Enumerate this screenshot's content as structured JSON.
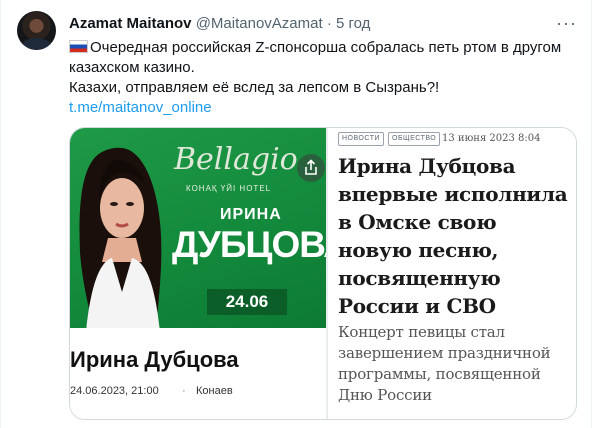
{
  "tweet": {
    "author_name": "Azamat Maitanov",
    "handle": "@MaitanovAzamat",
    "separator": "·",
    "time": "5 год",
    "more_label": "···",
    "text_line1": "Очередная российская Z-спонсорша собралась петь ртом в другом казахском казино.",
    "text_line2": "Казахи, отправляем её вслед за лепсом в Сызрань?!",
    "link": "t.me/maitanov_online",
    "flag_icon": "russia-flag-icon"
  },
  "poster": {
    "venue": "Bellagio",
    "venue_sub": "КОНАҚ ҮЙІ HOTEL",
    "singer_first": "ИРИНА",
    "singer_last": "ДУБЦОВА",
    "date": "24.06",
    "colors": {
      "green": "#1a9444",
      "dark_green": "#0b5e28"
    }
  },
  "caption": {
    "title": "Ирина Дубцова",
    "datetime": "24.06.2023, 21:00",
    "separator": "·",
    "place": "Конаев"
  },
  "article": {
    "tags": [
      "НОВОСТИ",
      "ОБЩЕСТВО"
    ],
    "date": "13 июня 2023 8:04",
    "headline": "Ирина Дубцова впервые исполнила в Омске свою новую песню, посвященную России и СВО",
    "lead": "Концерт певицы стал завершением праздничной программы, посвященной Дню России"
  },
  "icons": {
    "share": "share-icon",
    "avatar": "avatar"
  }
}
